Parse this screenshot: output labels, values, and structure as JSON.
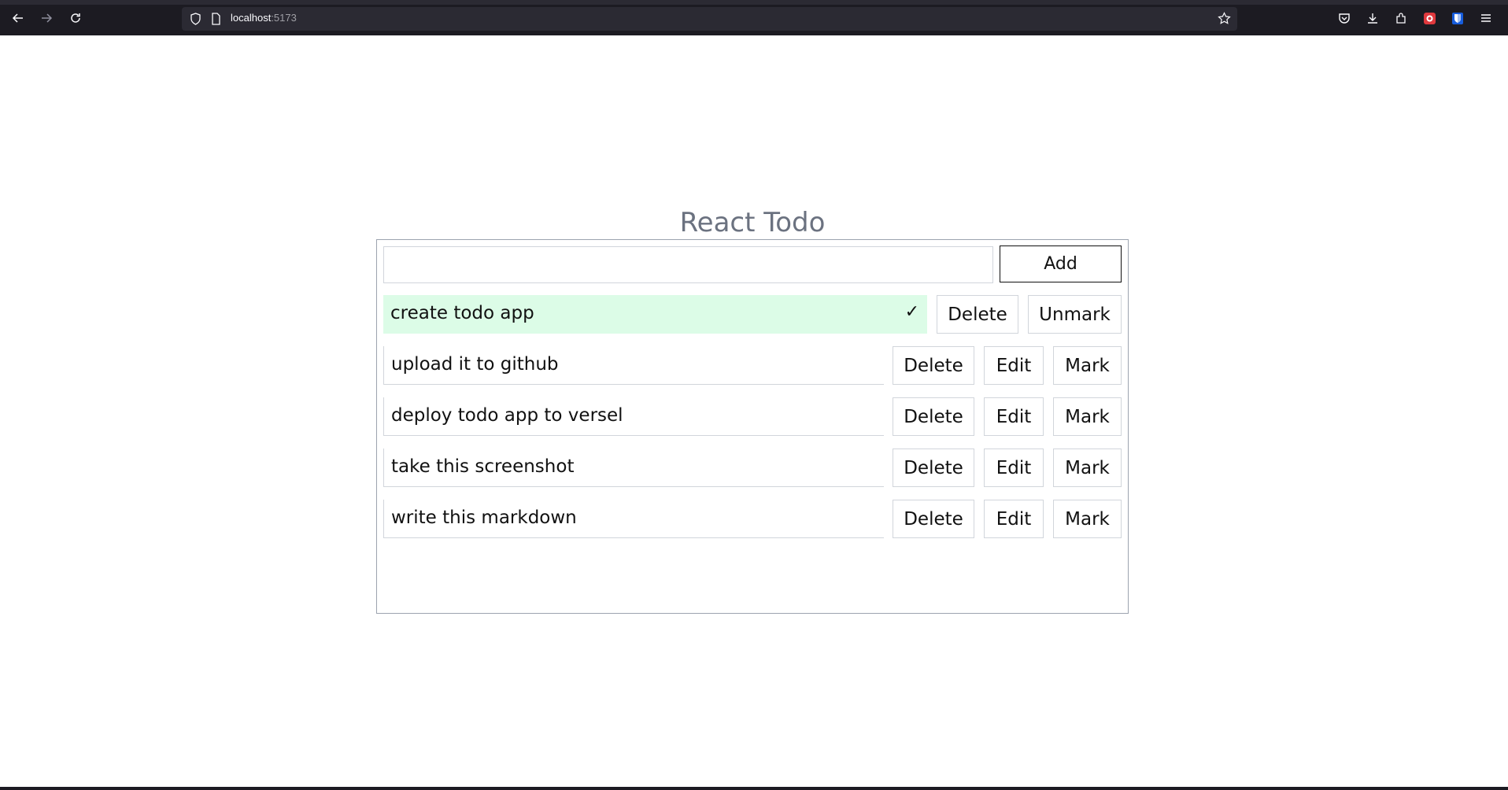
{
  "browser": {
    "url_host": "localhost",
    "url_port": ":5173",
    "icons": [
      "back-icon",
      "forward-icon",
      "reload-icon",
      "shield-icon",
      "page-icon",
      "bookmark-star-icon",
      "pocket-icon",
      "download-icon",
      "extensions-icon",
      "extension-red-icon",
      "bitwarden-icon",
      "menu-icon"
    ]
  },
  "app": {
    "title": "React Todo",
    "input_value": "",
    "add_label": "Add",
    "delete_label": "Delete",
    "edit_label": "Edit",
    "mark_label": "Mark",
    "unmark_label": "Unmark",
    "check_glyph": "✓"
  },
  "todos": [
    {
      "text": "create todo app",
      "done": true
    },
    {
      "text": "upload it to github",
      "done": false
    },
    {
      "text": "deploy todo app to versel",
      "done": false
    },
    {
      "text": "take this screenshot",
      "done": false
    },
    {
      "text": "write this markdown",
      "done": false
    }
  ],
  "colors": {
    "done_bg": "#dcfce7",
    "title": "#6b7280",
    "chrome_bg": "#1c1b22"
  }
}
